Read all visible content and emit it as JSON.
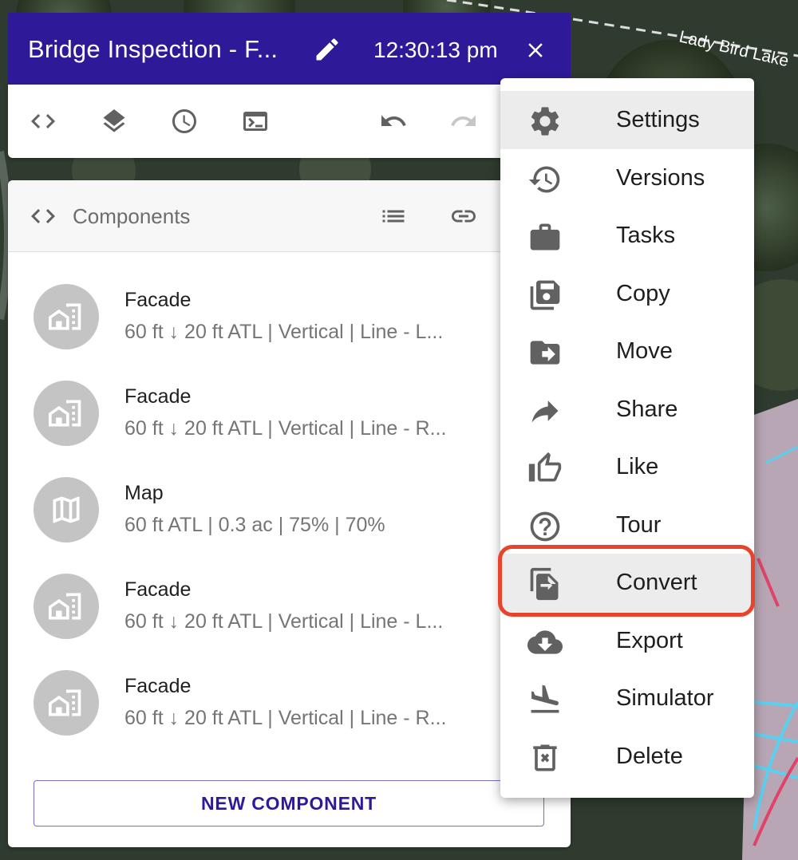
{
  "header": {
    "title": "Bridge Inspection - F...",
    "time": "12:30:13 pm"
  },
  "map": {
    "road_label": "Lady Bird Lake"
  },
  "components_panel": {
    "label": "Components",
    "items": [
      {
        "name": "Facade",
        "meta": "60 ft ↓ 20 ft ATL | Vertical | Line - L...",
        "icon": "facade-icon"
      },
      {
        "name": "Facade",
        "meta": "60 ft ↓ 20 ft ATL | Vertical | Line - R...",
        "icon": "facade-icon"
      },
      {
        "name": "Map",
        "meta": "60 ft ATL | 0.3 ac | 75% | 70%",
        "icon": "map-icon"
      },
      {
        "name": "Facade",
        "meta": "60 ft ↓ 20 ft ATL | Vertical | Line - L...",
        "icon": "facade-icon"
      },
      {
        "name": "Facade",
        "meta": "60 ft ↓ 20 ft ATL | Vertical | Line - R...",
        "icon": "facade-icon"
      }
    ],
    "new_button": "NEW COMPONENT"
  },
  "menu": {
    "items": [
      {
        "label": "Settings",
        "icon": "gear-icon"
      },
      {
        "label": "Versions",
        "icon": "history-icon"
      },
      {
        "label": "Tasks",
        "icon": "briefcase-icon"
      },
      {
        "label": "Copy",
        "icon": "copy-save-icon"
      },
      {
        "label": "Move",
        "icon": "folder-move-icon"
      },
      {
        "label": "Share",
        "icon": "share-icon"
      },
      {
        "label": "Like",
        "icon": "thumbs-up-icon"
      },
      {
        "label": "Tour",
        "icon": "help-circle-icon"
      },
      {
        "label": "Convert",
        "icon": "convert-icon"
      },
      {
        "label": "Export",
        "icon": "cloud-download-icon"
      },
      {
        "label": "Simulator",
        "icon": "airplane-landing-icon"
      },
      {
        "label": "Delete",
        "icon": "trash-icon"
      }
    ]
  },
  "colors": {
    "header_bg": "#2e1a99",
    "accent": "#2e1a99",
    "highlight_ring": "#e8432b",
    "icon_gray": "#616161"
  }
}
